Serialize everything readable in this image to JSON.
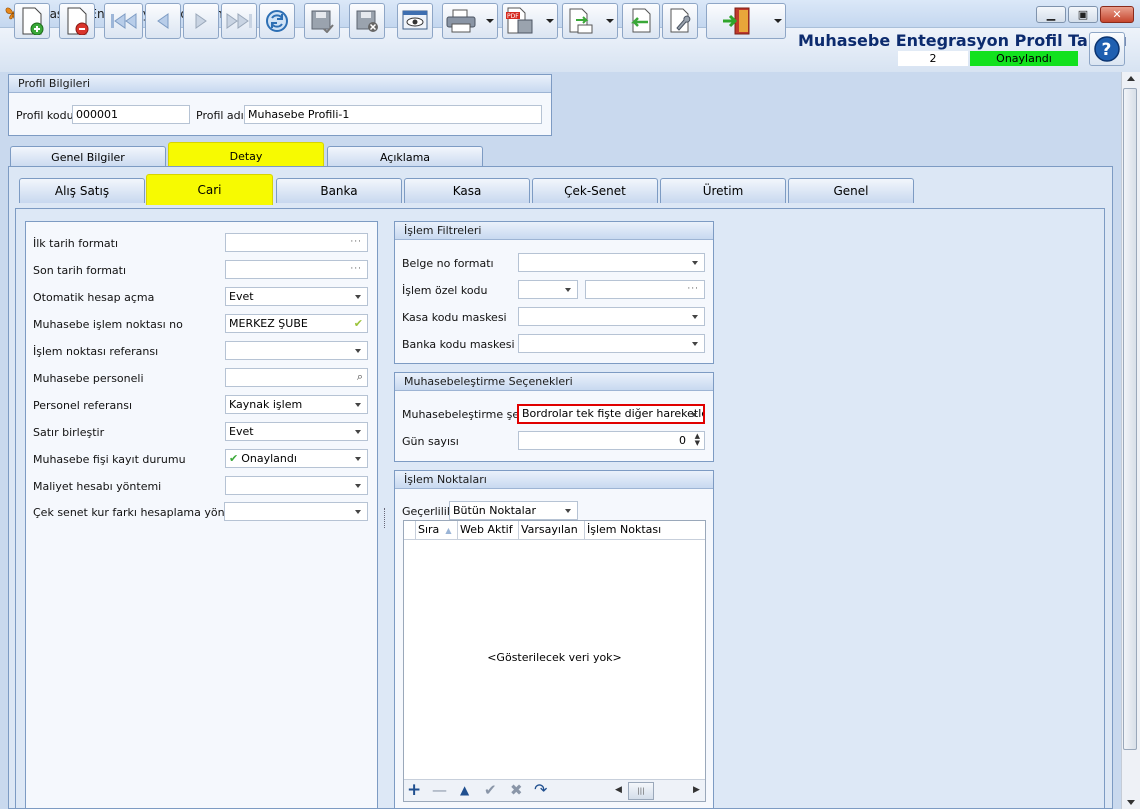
{
  "window": {
    "title": "Muhasebe Entegrasyon Profil Tanımı"
  },
  "header": {
    "title": "Muhasebe Entegrasyon Profil Tanımı",
    "count": "2",
    "status": "Onaylandı",
    "status_color": "#12e11e"
  },
  "profil": {
    "group_title": "Profil Bilgileri",
    "kod_label": "Profil kodu",
    "kod_value": "000001",
    "ad_label": "Profil adı",
    "ad_value": "Muhasebe Profili-1"
  },
  "tabs_top": [
    "Genel Bilgiler",
    "Detay",
    "Açıklama"
  ],
  "tabs_sub": [
    "Alış Satış",
    "Cari",
    "Banka",
    "Kasa",
    "Çek-Senet",
    "Üretim",
    "Genel"
  ],
  "left_form": [
    {
      "label": "İlk tarih formatı",
      "value": "",
      "kind": "ellipsis"
    },
    {
      "label": "Son tarih formatı",
      "value": "",
      "kind": "ellipsis"
    },
    {
      "label": "Otomatik hesap açma",
      "value": "Evet",
      "kind": "dropdown"
    },
    {
      "label": "Muhasebe işlem noktası no",
      "value": "MERKEZ ŞUBE",
      "kind": "check"
    },
    {
      "label": "İşlem noktası referansı",
      "value": "",
      "kind": "dropdown"
    },
    {
      "label": "Muhasebe personeli",
      "value": "",
      "kind": "lookup"
    },
    {
      "label": "Personel referansı",
      "value": "Kaynak işlem",
      "kind": "dropdown"
    },
    {
      "label": "Satır birleştir",
      "value": "Evet",
      "kind": "dropdown"
    },
    {
      "label": "Muhasebe fişi kayıt durumu",
      "value": "Onaylandı",
      "kind": "dropdown-check"
    },
    {
      "label": "Maliyet hesabı yöntemi",
      "value": "",
      "kind": "dropdown"
    },
    {
      "label": "Çek senet kur farkı hesaplama yöntemi",
      "value": "",
      "kind": "dropdown"
    }
  ],
  "islem_filtreleri": {
    "title": "İşlem Filtreleri",
    "belge_label": "Belge no formatı",
    "ozel_label": "İşlem özel kodu",
    "kasa_label": "Kasa kodu maskesi",
    "banka_label": "Banka kodu maskesi"
  },
  "muhasebe_secenekleri": {
    "title": "Muhasebeleştirme Seçenekleri",
    "sekli_label": "Muhasebeleştirme şekli",
    "sekli_value": "Bordrolar tek fişte diğer hareketler",
    "gun_label": "Gün sayısı",
    "gun_value": "0"
  },
  "islem_noktalari": {
    "title": "İşlem Noktaları",
    "gecerlilik_label": "Geçerlilik",
    "gecerlilik_value": "Bütün Noktalar",
    "columns": [
      "Sıra",
      "Web Aktif",
      "Varsayılan",
      "İşlem Noktası"
    ],
    "empty_text": "<Gösterilecek veri yok>"
  }
}
